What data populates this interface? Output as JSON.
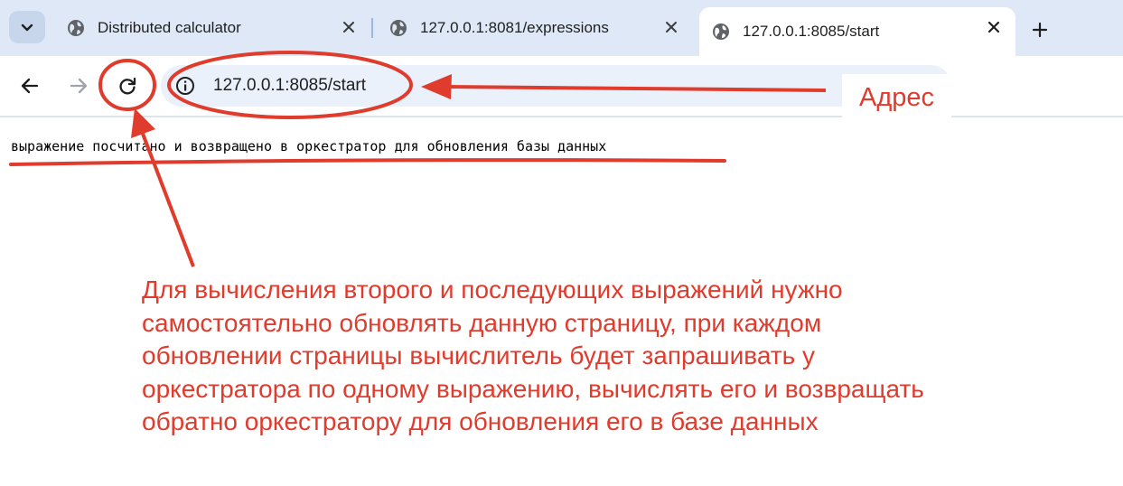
{
  "tabs": [
    {
      "title": "Distributed calculator",
      "active": false
    },
    {
      "title": "127.0.0.1:8081/expressions",
      "active": false
    },
    {
      "title": "127.0.0.1:8085/start",
      "active": true
    }
  ],
  "icons": {
    "tab_search": "chevron-down-icon",
    "favicon": "globe-icon",
    "close": "close-icon",
    "new_tab": "plus-icon",
    "back": "back-arrow-icon",
    "forward": "forward-arrow-icon",
    "reload": "reload-icon",
    "site_info": "info-icon"
  },
  "omnibox": {
    "url": "127.0.0.1:8085/start"
  },
  "page": {
    "message": "выражение посчитано и возвращено в оркестратор для обновления базы данных"
  },
  "annotations": {
    "address_label": "Адрес",
    "note": "Для вычисления второго и последующих выражений нужно самостоятельно обновлять данную страницу, при каждом обновлении страницы вычислитель будет запрашивать у оркестратора по одному выражению, вычислять его и возвращать обратно оркестратору для обновления его в базе данных"
  },
  "colors": {
    "annotation_red": "#e03c2e",
    "tabstrip_bg": "#dfe8f6",
    "omnibox_bg": "#eaf1fb"
  }
}
